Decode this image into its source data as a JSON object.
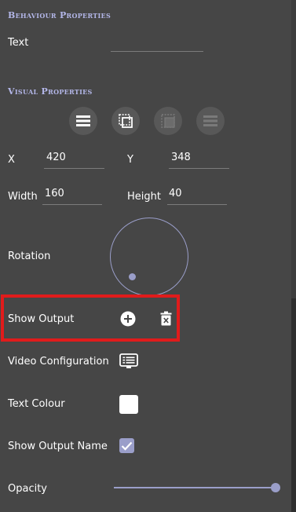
{
  "behaviour": {
    "header": "Behaviour Properties",
    "text_label": "Text",
    "text_value": ""
  },
  "visual": {
    "header": "Visual Properties",
    "toolbar_icons": [
      "align-top-icon",
      "select-frame-icon",
      "select-inner-icon",
      "align-bottom-icon"
    ],
    "x_label": "X",
    "x_value": "420",
    "y_label": "Y",
    "y_value": "348",
    "width_label": "Width",
    "width_value": "160",
    "height_label": "Height",
    "height_value": "40",
    "rotation_label": "Rotation"
  },
  "output": {
    "show_output_label": "Show Output",
    "video_config_label": "Video Configuration",
    "text_colour_label": "Text Colour",
    "text_colour_value": "#ffffff",
    "show_output_name_label": "Show Output Name",
    "show_output_name_checked": true,
    "opacity_label": "Opacity",
    "opacity_value": 1.0
  },
  "colors": {
    "panel_bg": "#464646",
    "accent": "#9a9ec9",
    "header": "#b3b6e8",
    "highlight": "#e01b1b"
  }
}
